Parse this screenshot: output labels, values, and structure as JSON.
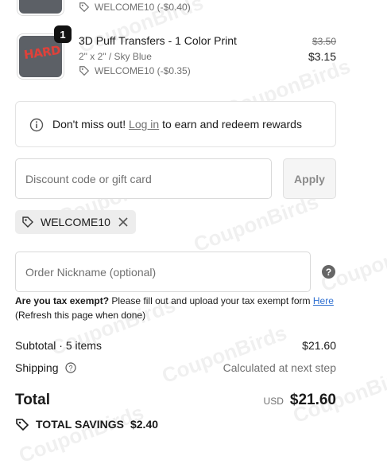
{
  "items": [
    {
      "discount": "WELCOME10 (-$0.40)"
    },
    {
      "quantity": "1",
      "title": "3D Puff Transfers - 1 Color Print",
      "variant": "2\" x 2\" / Sky Blue",
      "discount": "WELCOME10 (-$0.35)",
      "original_price": "$3.50",
      "price": "$3.15",
      "thumb_text": "HARD"
    }
  ],
  "rewards": {
    "text_before": "Don't miss out!",
    "link": "Log in",
    "text_after": "to earn and redeem rewards"
  },
  "discount": {
    "placeholder": "Discount code or gift card",
    "apply_label": "Apply",
    "applied_code": "WELCOME10"
  },
  "nickname": {
    "placeholder": "Order Nickname (optional)"
  },
  "tax": {
    "bold": "Are you tax exempt?",
    "text": "Please fill out and upload your tax exempt form",
    "link": "Here",
    "note": "(Refresh this page when done)"
  },
  "summary": {
    "subtotal_label": "Subtotal · 5 items",
    "subtotal_value": "$21.60",
    "shipping_label": "Shipping",
    "shipping_value": "Calculated at next step",
    "total_label": "Total",
    "currency": "USD",
    "total_value": "$21.60",
    "savings_label": "TOTAL SAVINGS",
    "savings_value": "$2.40"
  },
  "watermark": "CouponBirds",
  "colors": {
    "link": "#2e6fd1",
    "text": "#1a1a1a",
    "muted": "#707070"
  }
}
